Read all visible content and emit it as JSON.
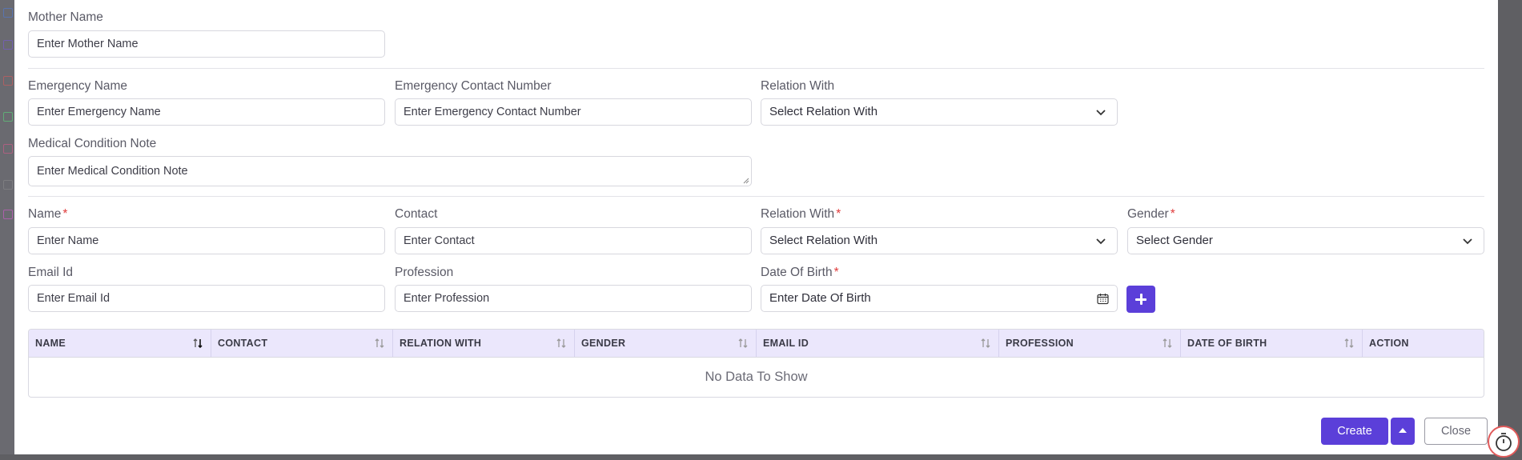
{
  "colors": {
    "accent": "#5b3fd9",
    "required": "#e03b3b",
    "table_header_bg": "#ebe7fc"
  },
  "mother": {
    "label": "Mother Name",
    "placeholder": "Enter Mother Name"
  },
  "emergency": {
    "name_label": "Emergency Name",
    "name_placeholder": "Enter Emergency Name",
    "contact_label": "Emergency Contact Number",
    "contact_placeholder": "Enter Emergency Contact Number",
    "relation_label": "Relation With",
    "relation_value": "Select Relation With",
    "medical_label": "Medical Condition Note",
    "medical_placeholder": "Enter Medical Condition Note"
  },
  "family": {
    "name_label": "Name",
    "name_placeholder": "Enter Name",
    "contact_label": "Contact",
    "contact_placeholder": "Enter Contact",
    "relation_label": "Relation With",
    "relation_value": "Select Relation With",
    "gender_label": "Gender",
    "gender_value": "Select Gender",
    "email_label": "Email Id",
    "email_placeholder": "Enter Email Id",
    "profession_label": "Profession",
    "profession_placeholder": "Enter Profession",
    "dob_label": "Date Of Birth",
    "dob_placeholder": "Enter Date Of Birth",
    "required_mark": "*"
  },
  "table": {
    "columns": [
      "NAME",
      "CONTACT",
      "RELATION WITH",
      "GENDER",
      "EMAIL ID",
      "PROFESSION",
      "DATE OF BIRTH",
      "ACTION"
    ],
    "empty_text": "No Data To Show"
  },
  "footer": {
    "create_label": "Create",
    "close_label": "Close"
  },
  "icons": {
    "add": "plus-icon",
    "calendar": "calendar-icon",
    "chevron": "chevron-down-icon",
    "sort": "sort-icon",
    "caret": "caret-up-icon",
    "timer": "timer-icon"
  }
}
